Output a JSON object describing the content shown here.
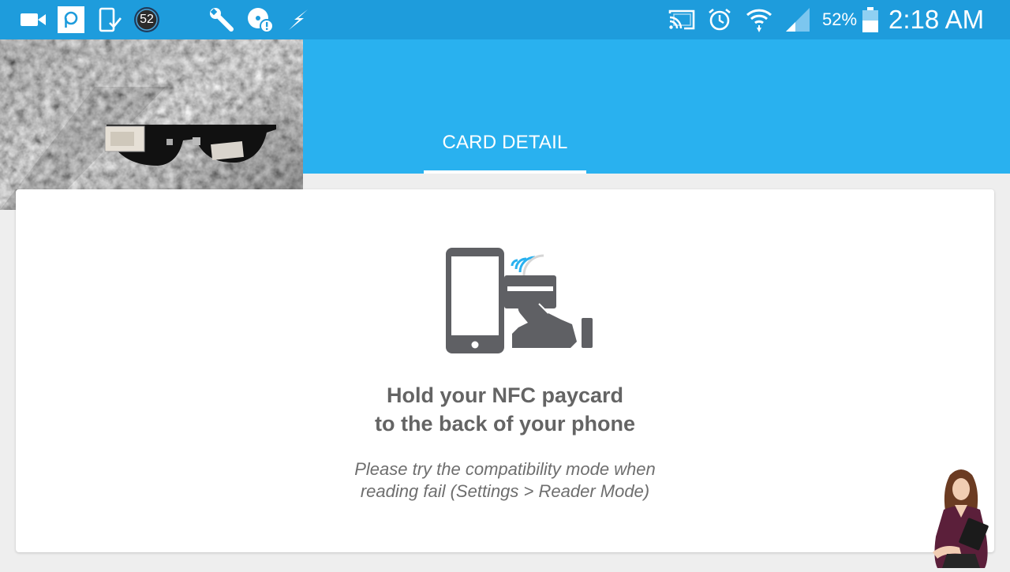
{
  "status_bar": {
    "notification_badge": "52",
    "battery_percent": "52%",
    "time": "2:18 AM",
    "icons": [
      "video-camera-icon",
      "app-p-icon",
      "phone-download-icon",
      "badge-52-icon",
      "wrench-icon",
      "alert-disc-icon",
      "flash-icon",
      "cast-icon",
      "alarm-icon",
      "wifi-icon",
      "signal-icon",
      "battery-icon"
    ]
  },
  "app_bar": {
    "tabs": [
      {
        "label": "CARD DETAIL",
        "selected": true
      }
    ]
  },
  "card": {
    "headline": "Hold your NFC paycard\nto the back of your phone",
    "hint_line1": "Please try the compatibility mode when",
    "hint_line2": "reading fail (Settings > Reader Mode)"
  },
  "colors": {
    "status_bar": "#1e9cdc",
    "app_bar": "#29b1ef",
    "icon_gray": "#5f6064",
    "nfc_waves": "#29b1ef",
    "card_bg": "#ffffff",
    "page_bg": "#eeeeee"
  }
}
